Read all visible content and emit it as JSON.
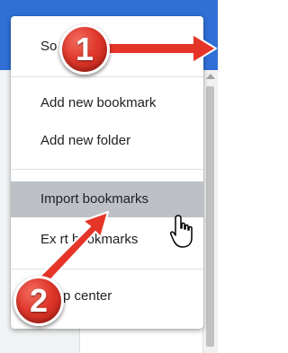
{
  "menu": {
    "items": [
      {
        "label": "So",
        "highlighted": false
      },
      {
        "label": "Add new bookmark",
        "highlighted": false
      },
      {
        "label": "Add new folder",
        "highlighted": false
      },
      {
        "label": "Import bookmarks",
        "highlighted": true
      },
      {
        "label": "Ex  rt bookmarks",
        "highlighted": false
      },
      {
        "label": "p center",
        "highlighted": false
      }
    ]
  },
  "annotations": {
    "badge_1": "1",
    "badge_2": "2"
  },
  "colors": {
    "app_bar": "#2f6fd6",
    "menu_highlight": "#bdc1c6",
    "callout_red": "#e0392c"
  },
  "icons": {
    "cursor": "hand-pointer-icon"
  }
}
